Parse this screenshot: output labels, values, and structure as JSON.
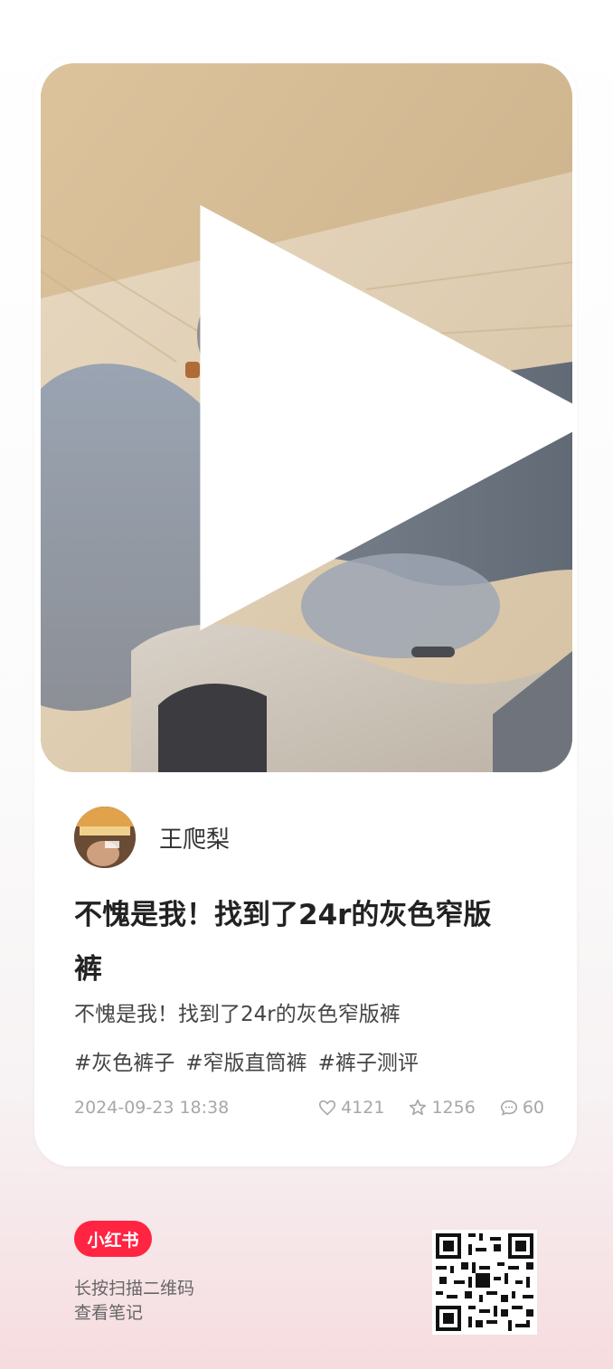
{
  "post": {
    "author_name": "王爬梨",
    "title_line1": "不愧是我！找到了24r的灰色窄版",
    "title_line2": "裤",
    "description": "不愧是我！找到了24r的灰色窄版裤",
    "tags": [
      "#灰色裤子",
      "#窄版直筒裤",
      "#裤子测评"
    ],
    "date": "2024-09-23 18:38",
    "likes": "4121",
    "favorites": "1256",
    "comments": "60"
  },
  "footer": {
    "brand": "小红书",
    "hint_line1": "长按扫描二维码",
    "hint_line2": "查看笔记"
  },
  "icons": {
    "play": "play-icon",
    "like": "heart-icon",
    "favorite": "star-icon",
    "comment": "comment-icon"
  },
  "colors": {
    "brand": "#ff2442",
    "meta_text": "#a7a7a7"
  }
}
